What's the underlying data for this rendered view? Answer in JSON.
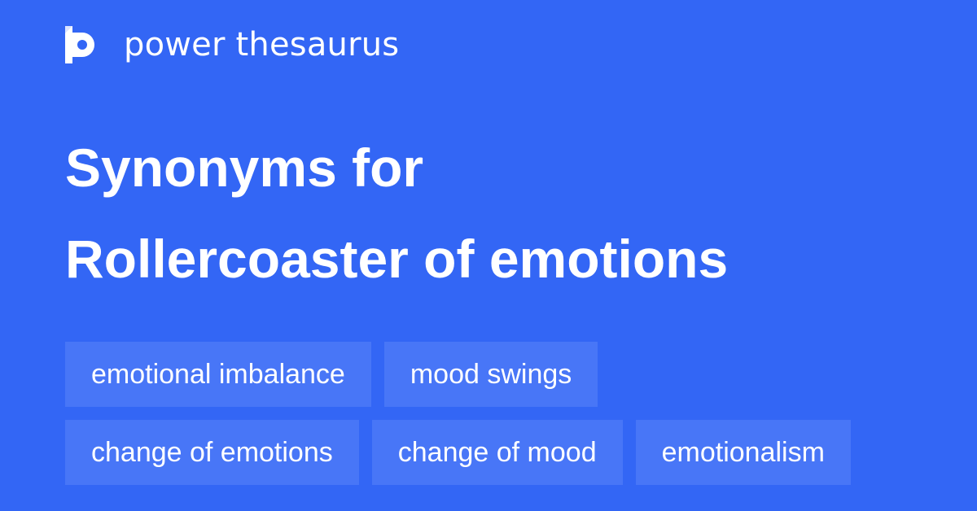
{
  "brand": {
    "name": "power thesaurus",
    "logo_icon": "power-thesaurus-logo"
  },
  "headline": {
    "line1": "Synonyms for",
    "line2": "Rollercoaster of emotions"
  },
  "synonyms": {
    "row1": [
      "emotional imbalance",
      "mood swings"
    ],
    "row2": [
      "change of emotions",
      "change of mood",
      "emotionalism"
    ]
  },
  "colors": {
    "background": "#3366f5",
    "chip": "#4876f7",
    "text": "#ffffff"
  }
}
